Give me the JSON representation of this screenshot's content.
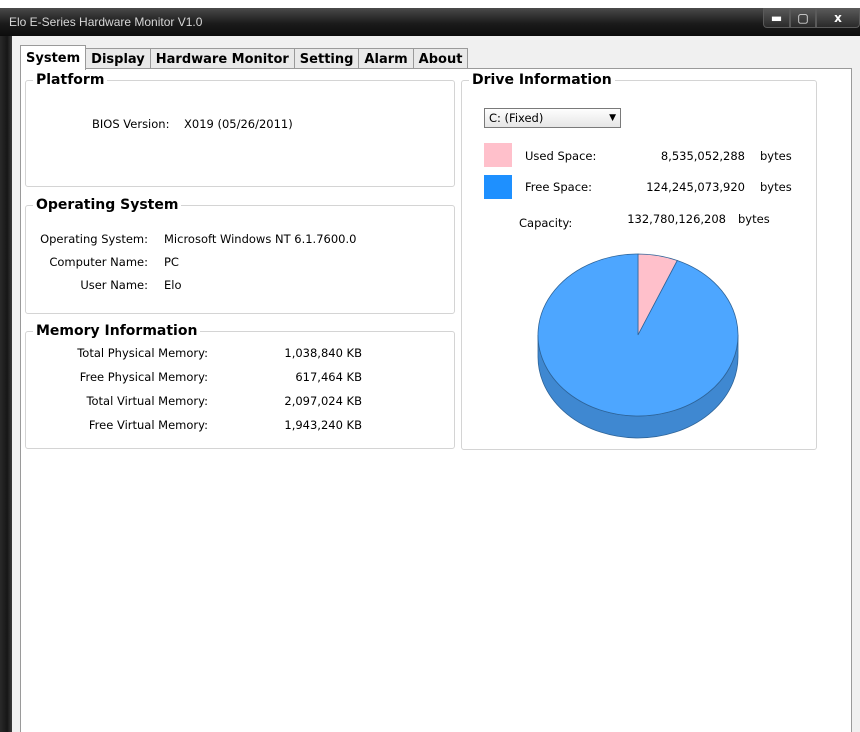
{
  "window": {
    "title": "Elo E-Series Hardware Monitor V1.0",
    "buttons": {
      "minimize": "▬",
      "maximize": "▢",
      "close": "x"
    }
  },
  "tabs": [
    {
      "label": "System",
      "active": true
    },
    {
      "label": "Display",
      "active": false
    },
    {
      "label": "Hardware Monitor",
      "active": false
    },
    {
      "label": "Setting",
      "active": false
    },
    {
      "label": "Alarm",
      "active": false
    },
    {
      "label": "About",
      "active": false
    }
  ],
  "platform": {
    "title": "Platform",
    "bios_label": "BIOS Version:",
    "bios_value": "X019 (05/26/2011)"
  },
  "os": {
    "title": "Operating System",
    "rows": [
      {
        "label": "Operating System:",
        "value": "Microsoft Windows NT 6.1.7600.0"
      },
      {
        "label": "Computer Name:",
        "value": "PC"
      },
      {
        "label": "User Name:",
        "value": "Elo"
      }
    ]
  },
  "memory": {
    "title": "Memory Information",
    "rows": [
      {
        "label": "Total Physical Memory:",
        "value": "1,038,840 KB"
      },
      {
        "label": "Free Physical Memory:",
        "value": "617,464 KB"
      },
      {
        "label": "Total Virtual Memory:",
        "value": "2,097,024 KB"
      },
      {
        "label": "Free Virtual Memory:",
        "value": "1,943,240 KB"
      }
    ]
  },
  "drive": {
    "title": "Drive Information",
    "selected_drive": "C: (Fixed)",
    "used_label": "Used Space:",
    "used_value": "8,535,052,288",
    "free_label": "Free Space:",
    "free_value": "124,245,073,920",
    "capacity_label": "Capacity:",
    "capacity_value": "132,780,126,208",
    "unit": "bytes",
    "colors": {
      "used": "#ffc0cb",
      "free": "#1e90ff"
    }
  },
  "chart_data": {
    "type": "pie",
    "categories": [
      "Used Space",
      "Free Space"
    ],
    "values": [
      8535052288,
      124245073920
    ],
    "colors": [
      "#ffc0cb",
      "#4da6ff"
    ]
  }
}
